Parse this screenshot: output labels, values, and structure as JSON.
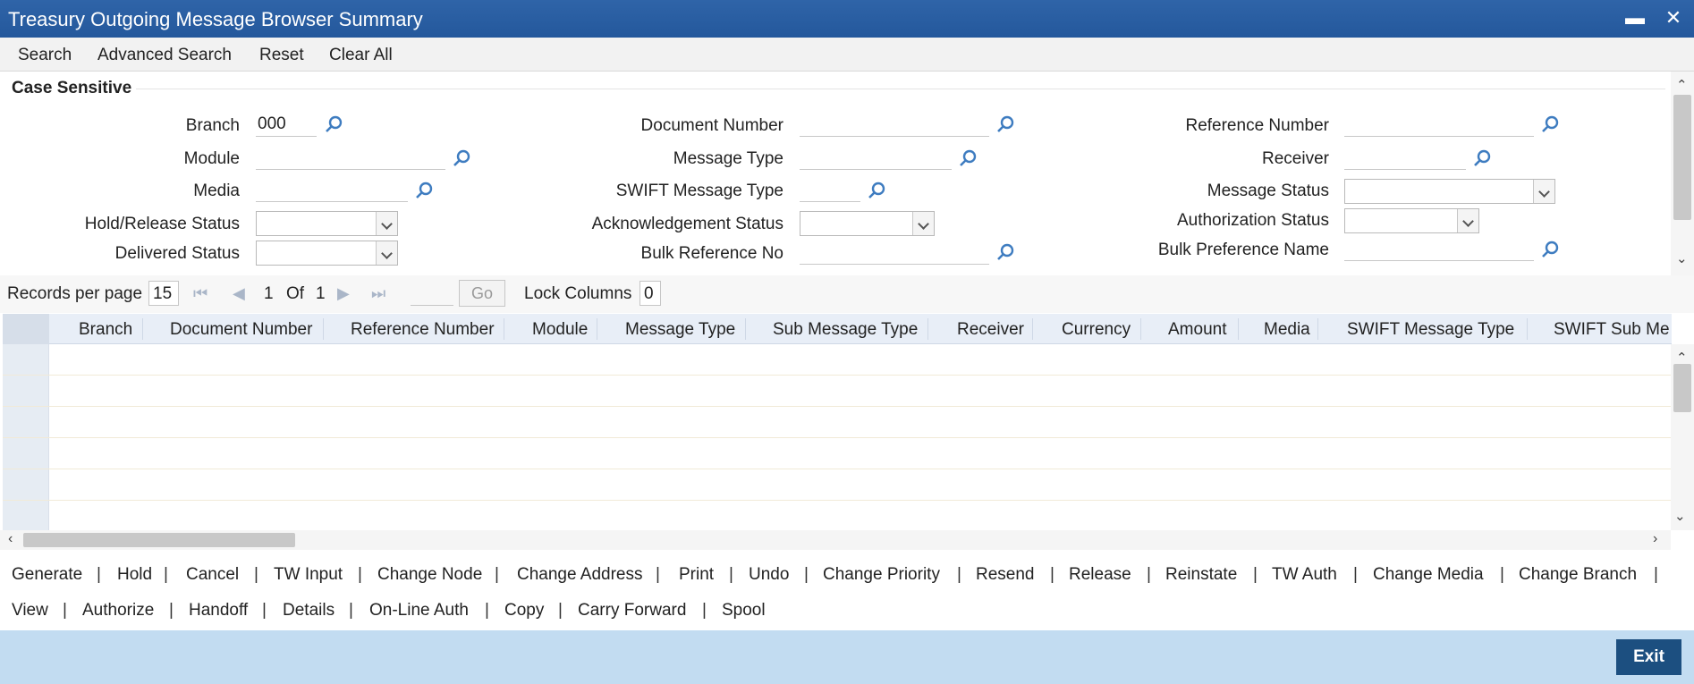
{
  "window": {
    "title": "Treasury Outgoing Message Browser Summary",
    "minimize_icon": "minimize-icon",
    "close_icon": "close-icon"
  },
  "menu": {
    "items": [
      "Search",
      "Advanced Search",
      "Reset",
      "Clear All"
    ]
  },
  "criteria": {
    "legend": "Case Sensitive",
    "fields": {
      "branch": {
        "label": "Branch",
        "value": "000"
      },
      "module": {
        "label": "Module",
        "value": ""
      },
      "media": {
        "label": "Media",
        "value": ""
      },
      "hold_release_status": {
        "label": "Hold/Release Status",
        "value": ""
      },
      "delivered_status": {
        "label": "Delivered Status",
        "value": ""
      },
      "document_number": {
        "label": "Document Number",
        "value": ""
      },
      "message_type": {
        "label": "Message Type",
        "value": ""
      },
      "swift_message_type": {
        "label": "SWIFT Message Type",
        "value": ""
      },
      "acknowledgement_status": {
        "label": "Acknowledgement Status",
        "value": ""
      },
      "bulk_reference_no": {
        "label": "Bulk Reference No",
        "value": ""
      },
      "reference_number": {
        "label": "Reference Number",
        "value": ""
      },
      "receiver": {
        "label": "Receiver",
        "value": ""
      },
      "message_status": {
        "label": "Message Status",
        "value": ""
      },
      "authorization_status": {
        "label": "Authorization Status",
        "value": ""
      },
      "bulk_preference_name": {
        "label": "Bulk Preference Name",
        "value": ""
      }
    }
  },
  "pager": {
    "records_per_page_label": "Records per page",
    "records_per_page": "15",
    "current_page": "1",
    "of_label": "Of",
    "total_pages": "1",
    "go_label": "Go",
    "lock_columns_label": "Lock Columns",
    "lock_columns": "0"
  },
  "grid": {
    "columns": [
      "Branch",
      "Document Number",
      "Reference Number",
      "Module",
      "Message Type",
      "Sub Message Type",
      "Receiver",
      "Currency",
      "Amount",
      "Media",
      "SWIFT Message Type",
      "SWIFT Sub Me"
    ],
    "rows": []
  },
  "actions": {
    "row1": [
      "Generate",
      "Hold",
      "Cancel",
      "TW Input",
      "Change Node",
      "Change Address",
      "Print",
      "Undo",
      "Change Priority",
      "Resend",
      "Release",
      "Reinstate",
      "TW Auth",
      "Change Media",
      "Change Branch"
    ],
    "row2": [
      "View",
      "Authorize",
      "Handoff",
      "Details",
      "On-Line Auth",
      "Copy",
      "Carry Forward",
      "Spool"
    ]
  },
  "footer": {
    "exit_label": "Exit"
  },
  "colors": {
    "title_bar": "#2a5ea2",
    "footer": "#c2dcf1",
    "exit_button": "#1c4f80",
    "lookup_icon": "#3e7cc0"
  }
}
